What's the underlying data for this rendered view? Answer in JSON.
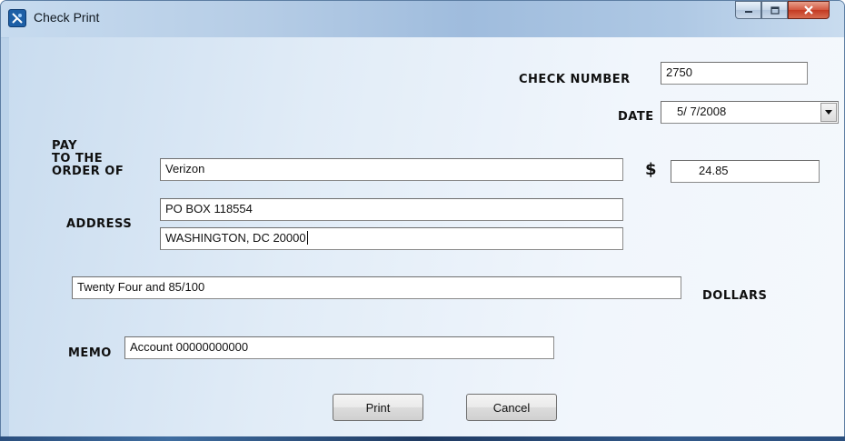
{
  "window": {
    "title": "Check Print",
    "controls": {
      "minimize_icon": "minimize-icon",
      "maximize_icon": "maximize-icon",
      "close_icon": "close-icon"
    }
  },
  "form": {
    "check_number_label": "CHECK NUMBER",
    "check_number_value": "2750",
    "date_label": "DATE",
    "date_value": "5/ 7/2008",
    "payee_label_line1": "PAY",
    "payee_label_line2": "TO THE",
    "payee_label_line3": "ORDER OF",
    "payee_value": "Verizon",
    "dollar_sign": "$",
    "amount_value": "24.85",
    "address_label": "ADDRESS",
    "address_line1": "PO BOX 118554",
    "address_line2": "WASHINGTON, DC 20000",
    "amount_words_value": "Twenty Four and 85/100",
    "dollars_label": "DOLLARS",
    "memo_label": "MEMO",
    "memo_value": "Account 00000000000"
  },
  "buttons": {
    "print_label": "Print",
    "cancel_label": "Cancel"
  }
}
